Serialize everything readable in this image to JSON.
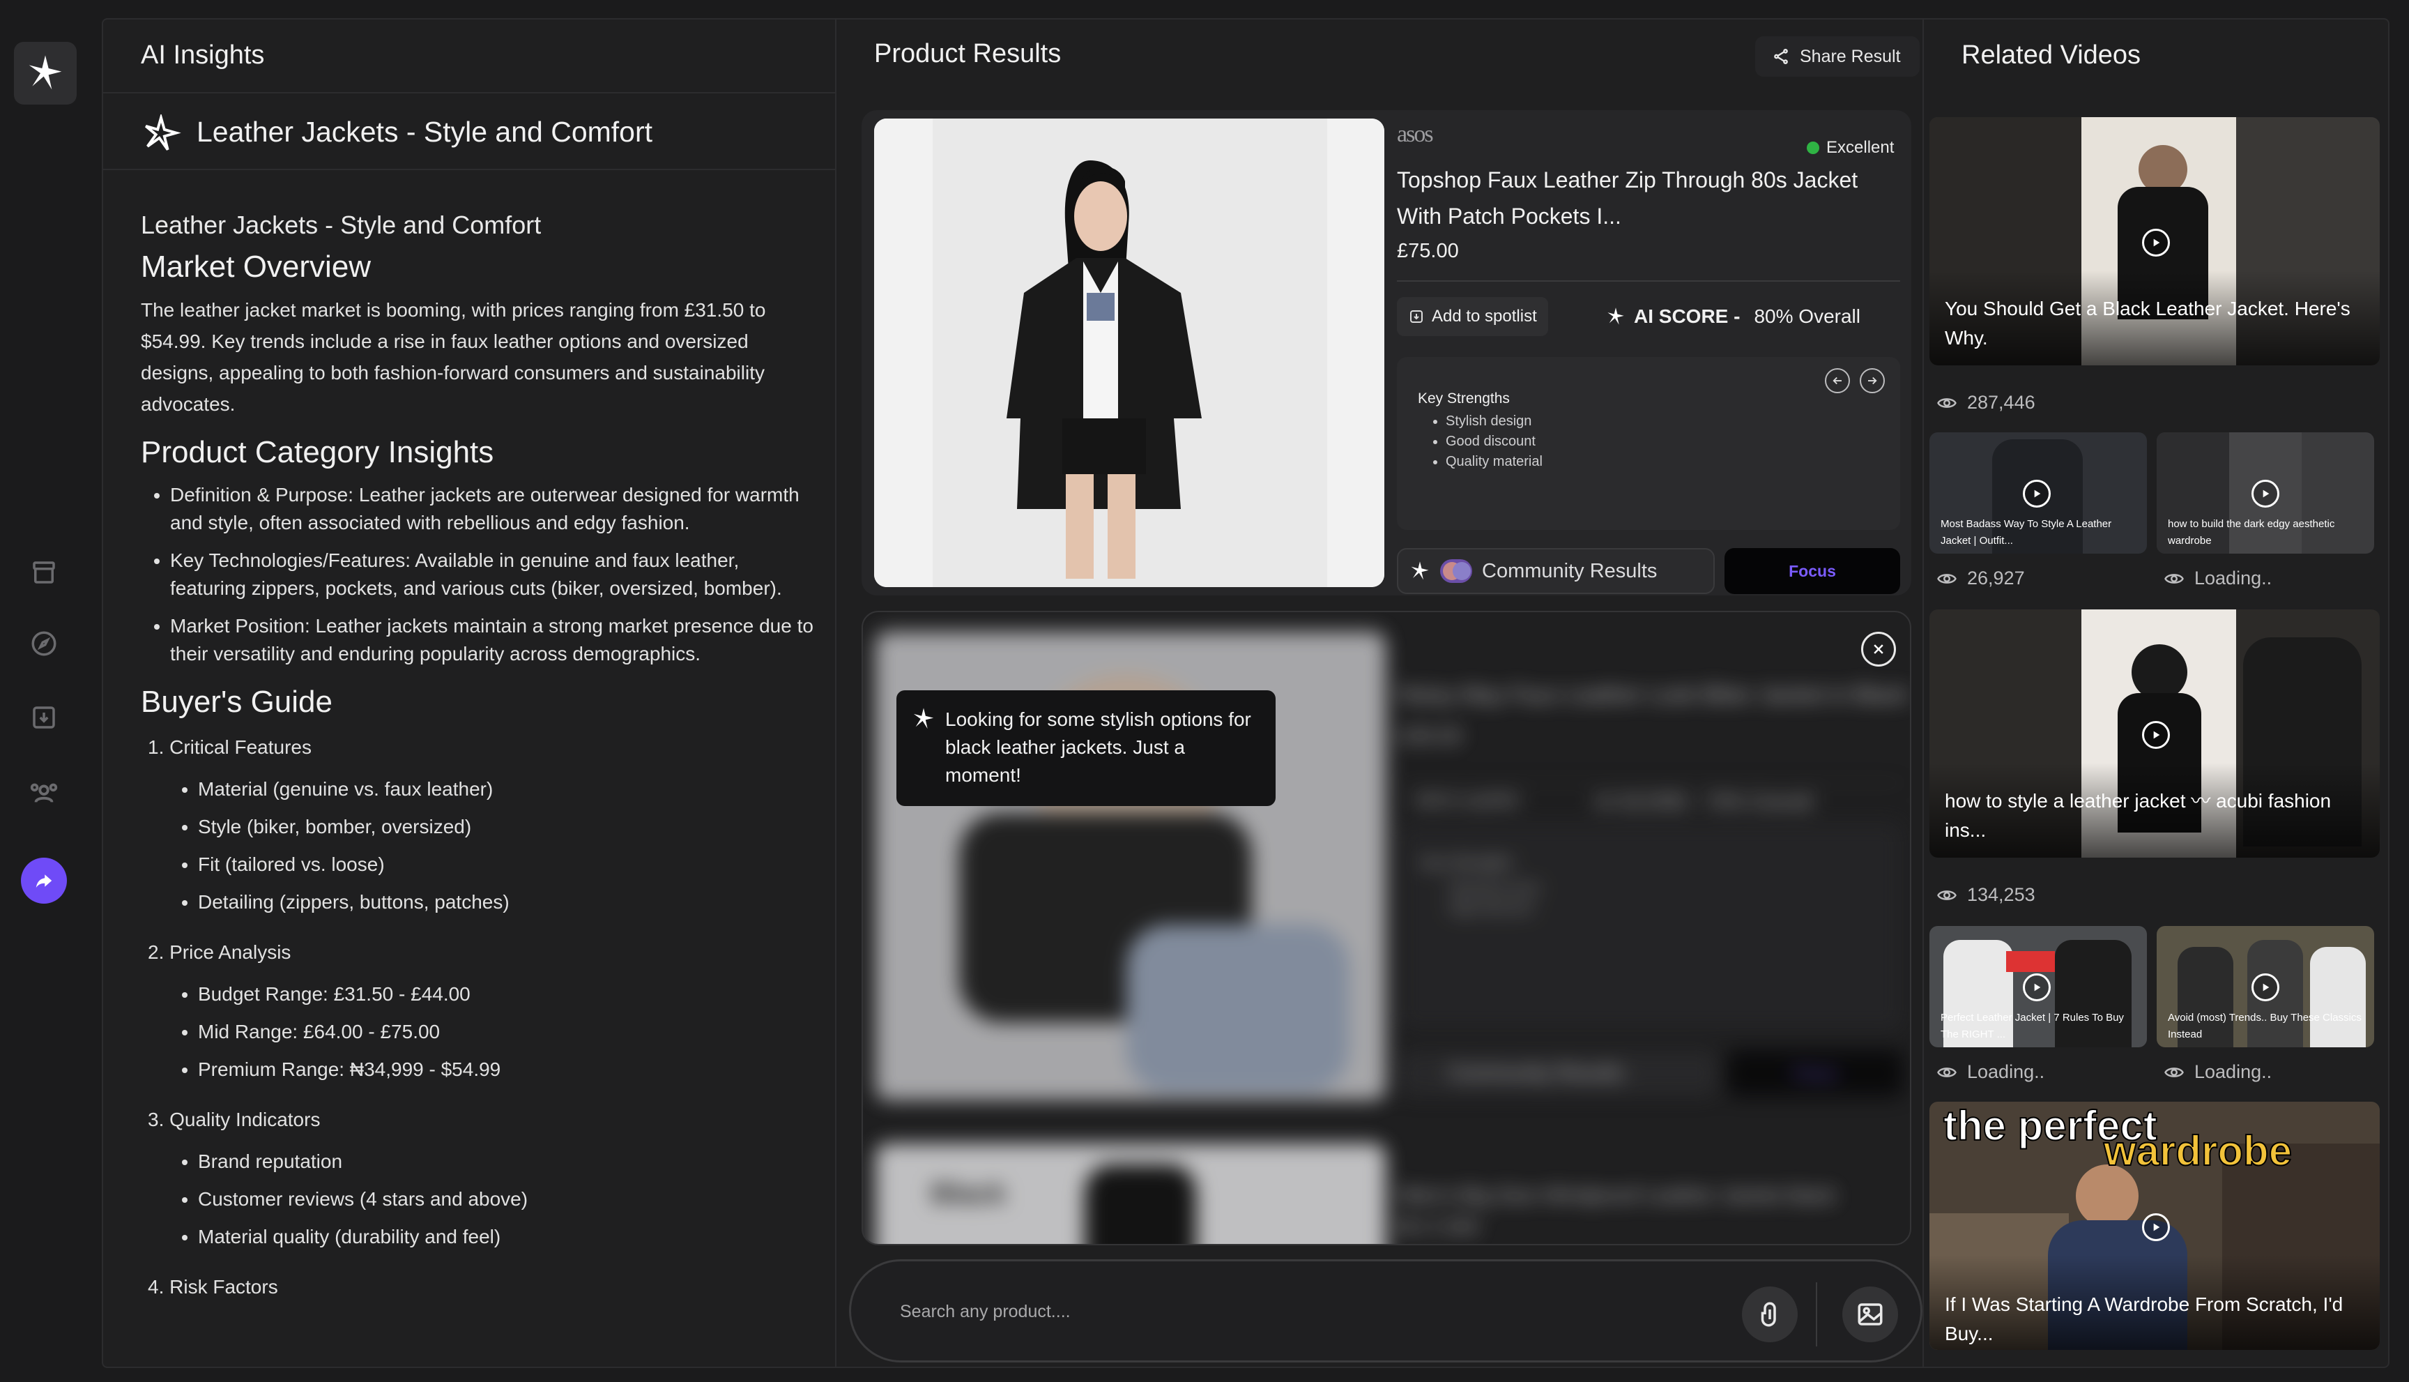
{
  "sidebar": {
    "icons": [
      "sparkle-logo-icon",
      "archive-icon",
      "compass-icon",
      "download-icon",
      "community-icon",
      "share-icon"
    ]
  },
  "insights": {
    "header": "AI Insights",
    "topic_title": "Leather Jackets - Style and Comfort",
    "sub_heading": "Leather Jackets - Style and Comfort",
    "market_overview": {
      "heading": "Market Overview",
      "text": "The leather jacket market is booming, with prices ranging from £31.50 to $54.99. Key trends include a rise in faux leather options and oversized designs, appealing to both fashion-forward consumers and sustainability advocates."
    },
    "category": {
      "heading": "Product Category Insights",
      "items": [
        {
          "label": "Definition & Purpose:",
          "text": " Leather jackets are outerwear designed for warmth and style, often associated with rebellious and edgy fashion."
        },
        {
          "label": "Key Technologies/Features:",
          "text": " Available in genuine and faux leather, featuring zippers, pockets, and various cuts (biker, oversized, bomber)."
        },
        {
          "label": "Market Position:",
          "text": " Leather jackets maintain a strong market presence due to their versatility and enduring popularity across demographics."
        }
      ]
    },
    "guide": {
      "heading": "Buyer's Guide",
      "sections": [
        {
          "title": "1. Critical Features",
          "items": [
            "Material (genuine vs. faux leather)",
            "Style (biker, bomber, oversized)",
            "Fit (tailored vs. loose)",
            "Detailing (zippers, buttons, patches)"
          ]
        },
        {
          "title": "2. Price Analysis",
          "items": [
            "Budget Range: £31.50 - £44.00",
            "Mid Range: £64.00 - £75.00",
            "Premium Range: ₦34,999 - $54.99"
          ]
        },
        {
          "title": "3. Quality Indicators",
          "items": [
            "Brand reputation",
            "Customer reviews (4 stars and above)",
            "Material quality (durability and feel)"
          ]
        },
        {
          "title": "4. Risk Factors",
          "items": []
        }
      ]
    }
  },
  "products": {
    "header": "Product Results",
    "share_label": "Share Result",
    "card": {
      "brand": "asos",
      "rating_label": "Excellent",
      "rating_color": "#2fb344",
      "name": "Topshop Faux Leather Zip Through 80s Jacket With Patch Pockets I...",
      "price": "£75.00",
      "spotlist_label": "Add to spotlist",
      "ai_score_label": "AI SCORE -",
      "ai_score_value": "80% Overall",
      "strengths_title": "Key Strengths",
      "strengths": [
        "Stylish design",
        "Good discount",
        "Quality material"
      ],
      "community_label": "Community Results",
      "focus_label": "Focus",
      "focus_color": "#7b5cff"
    },
    "blurred_card": {
      "name": "Noisy May Faux Leather Look Biker Jacket in Black",
      "price": "£35.00",
      "spotlist_label": "Add to spotlist",
      "ai_score_label": "AI SCORE -",
      "ai_score_value": "70% Overall",
      "strengths_title": "Key Strengths",
      "strengths": [
        "Attractive price",
        "High discount"
      ],
      "community_label": "Community Results",
      "focus_label": "Focus"
    },
    "blurred_card_2": {
      "image_text": "Black",
      "name": "Men's Big Size Windproof Leather Jacket black",
      "price": "₦ 17,000"
    },
    "toast": "Looking for some stylish options for black leather jackets. Just a moment!",
    "search_placeholder": "Search any product...."
  },
  "videos": {
    "header": "Related Videos",
    "large": [
      {
        "title": "You Should Get a Black Leather Jacket. Here's Why.",
        "views": "287,446"
      },
      {
        "title": "how to style a leather jacket 〰 acubi fashion ins...",
        "views": "134,253"
      },
      {
        "title": "If I Was Starting A Wardrobe From Scratch, I'd Buy...",
        "views": "",
        "overlay_line1": "the perfect",
        "overlay_line2": "wardrobe"
      }
    ],
    "small_row1": [
      {
        "title": "Most Badass Way To Style A Leather Jacket | Outfit...",
        "views": "26,927"
      },
      {
        "title": "how to build the dark edgy aesthetic wardrobe",
        "views": "Loading.."
      }
    ],
    "small_row2": [
      {
        "title": "Perfect Leather Jacket | 7 Rules To Buy The RIGHT ...",
        "views": "Loading.."
      },
      {
        "title": "Avoid (most) Trends.. Buy These Classics Instead",
        "views": "Loading.."
      }
    ]
  }
}
